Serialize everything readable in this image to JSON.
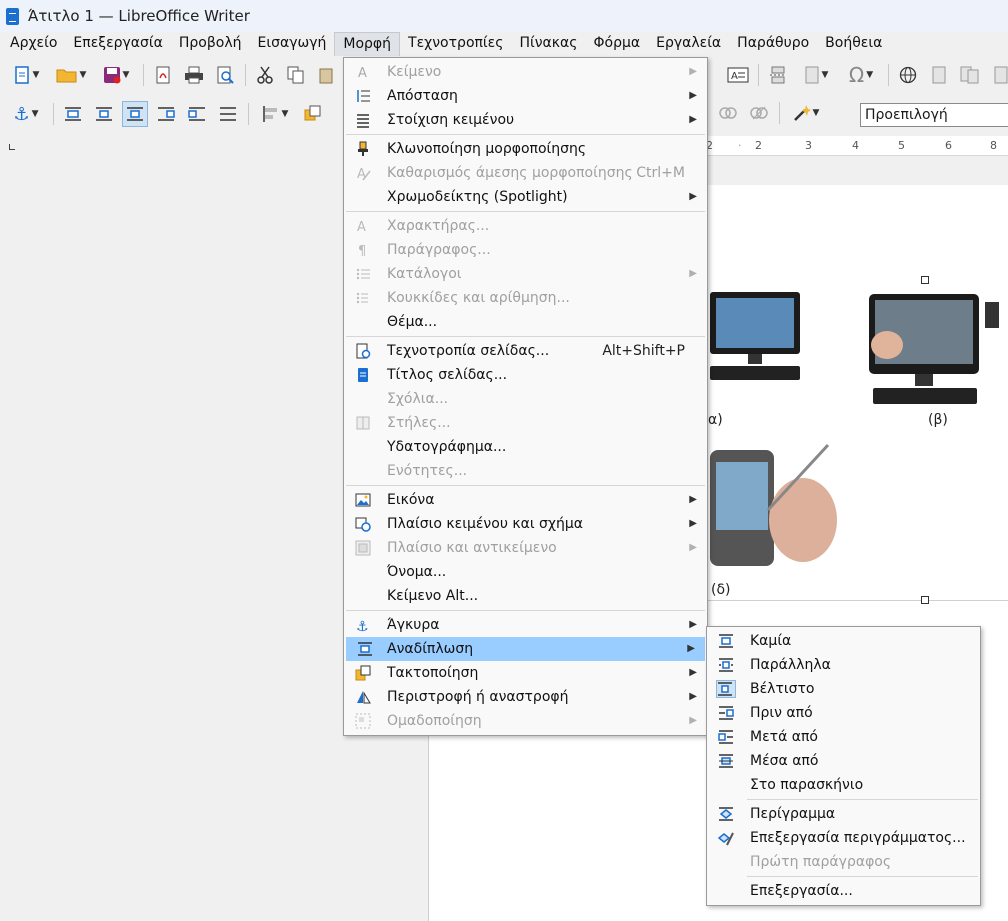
{
  "window": {
    "title": "Άτιτλο 1 — LibreOffice Writer"
  },
  "menubar": [
    "Αρχείο",
    "Επεξεργασία",
    "Προβολή",
    "Εισαγωγή",
    "Μορφή",
    "Τεχνοτροπίες",
    "Πίνακας",
    "Φόρμα",
    "Εργαλεία",
    "Παράθυρο",
    "Βοήθεια"
  ],
  "toolbar": {
    "paragraph_style": "Προεπιλογή"
  },
  "ruler": [
    "2",
    "1",
    "2",
    "3",
    "4",
    "5",
    "6",
    "7",
    "8"
  ],
  "document": {
    "captions": [
      "α)",
      "(β)",
      "(δ)"
    ]
  },
  "format_menu": {
    "items": [
      {
        "label": "Κείμενο",
        "disabled": true,
        "submenu": true,
        "icon": "text-icon"
      },
      {
        "label": "Απόσταση",
        "submenu": true,
        "icon": "spacing-icon"
      },
      {
        "label": "Στοίχιση κειμένου",
        "submenu": true,
        "icon": "align-icon"
      },
      {
        "sep": true
      },
      {
        "label": "Κλωνοποίηση μορφοποίησης",
        "icon": "clone-formatting-icon"
      },
      {
        "label": "Καθαρισμός άμεσης μορφοποίησης",
        "shortcut": "Ctrl+M",
        "disabled": true,
        "icon": "clear-formatting-icon"
      },
      {
        "label": "Χρωμοδείκτης (Spotlight)",
        "submenu": true
      },
      {
        "sep": true
      },
      {
        "label": "Χαρακτήρας...",
        "disabled": true,
        "icon": "character-icon"
      },
      {
        "label": "Παράγραφος...",
        "disabled": true,
        "icon": "paragraph-icon"
      },
      {
        "label": "Κατάλογοι",
        "disabled": true,
        "submenu": true,
        "icon": "lists-icon"
      },
      {
        "label": "Κουκκίδες και αρίθμηση...",
        "disabled": true,
        "icon": "bullets-icon"
      },
      {
        "label": "Θέμα..."
      },
      {
        "sep": true
      },
      {
        "label": "Τεχνοτροπία σελίδας...",
        "shortcut": "Alt+Shift+P",
        "icon": "page-style-icon"
      },
      {
        "label": "Τίτλος σελίδας...",
        "icon": "title-page-icon"
      },
      {
        "label": "Σχόλια...",
        "disabled": true
      },
      {
        "label": "Στήλες...",
        "disabled": true,
        "icon": "columns-icon"
      },
      {
        "label": "Υδατογράφημα..."
      },
      {
        "label": "Ενότητες...",
        "disabled": true
      },
      {
        "sep": true
      },
      {
        "label": "Εικόνα",
        "submenu": true,
        "icon": "image-icon"
      },
      {
        "label": "Πλαίσιο κειμένου και σχήμα",
        "submenu": true,
        "icon": "text-box-shape-icon"
      },
      {
        "label": "Πλαίσιο και αντικείμενο",
        "disabled": true,
        "submenu": true,
        "icon": "frame-object-icon"
      },
      {
        "label": "Όνομα..."
      },
      {
        "label": "Κείμενο Alt..."
      },
      {
        "sep": true
      },
      {
        "label": "Άγκυρα",
        "submenu": true,
        "icon": "anchor-icon"
      },
      {
        "label": "Αναδίπλωση",
        "submenu": true,
        "highlighted": true,
        "icon": "wrap-icon"
      },
      {
        "label": "Τακτοποίηση",
        "submenu": true,
        "icon": "arrange-icon"
      },
      {
        "label": "Περιστροφή ή αναστροφή",
        "submenu": true,
        "icon": "rotate-flip-icon"
      },
      {
        "label": "Ομαδοποίηση",
        "disabled": true,
        "submenu": true,
        "icon": "group-icon"
      }
    ]
  },
  "wrap_submenu": {
    "items": [
      {
        "label": "Καμία",
        "icon": "wrap-none-icon"
      },
      {
        "label": "Παράλληλα",
        "icon": "wrap-parallel-icon"
      },
      {
        "label": "Βέλτιστο",
        "icon": "wrap-optimal-icon",
        "selected": true
      },
      {
        "label": "Πριν από",
        "icon": "wrap-before-icon"
      },
      {
        "label": "Μετά από",
        "icon": "wrap-after-icon"
      },
      {
        "label": "Μέσα από",
        "icon": "wrap-through-icon"
      },
      {
        "label": "Στο παρασκήνιο"
      },
      {
        "sep": true
      },
      {
        "label": "Περίγραμμα",
        "icon": "contour-icon"
      },
      {
        "label": "Επεξεργασία περιγράμματος...",
        "icon": "edit-contour-icon"
      },
      {
        "label": "Πρώτη παράγραφος",
        "disabled": true
      },
      {
        "sep": true
      },
      {
        "label": "Επεξεργασία..."
      }
    ]
  },
  "colors": {
    "highlight": "#99ccff",
    "accent": "#1a6fd0"
  }
}
